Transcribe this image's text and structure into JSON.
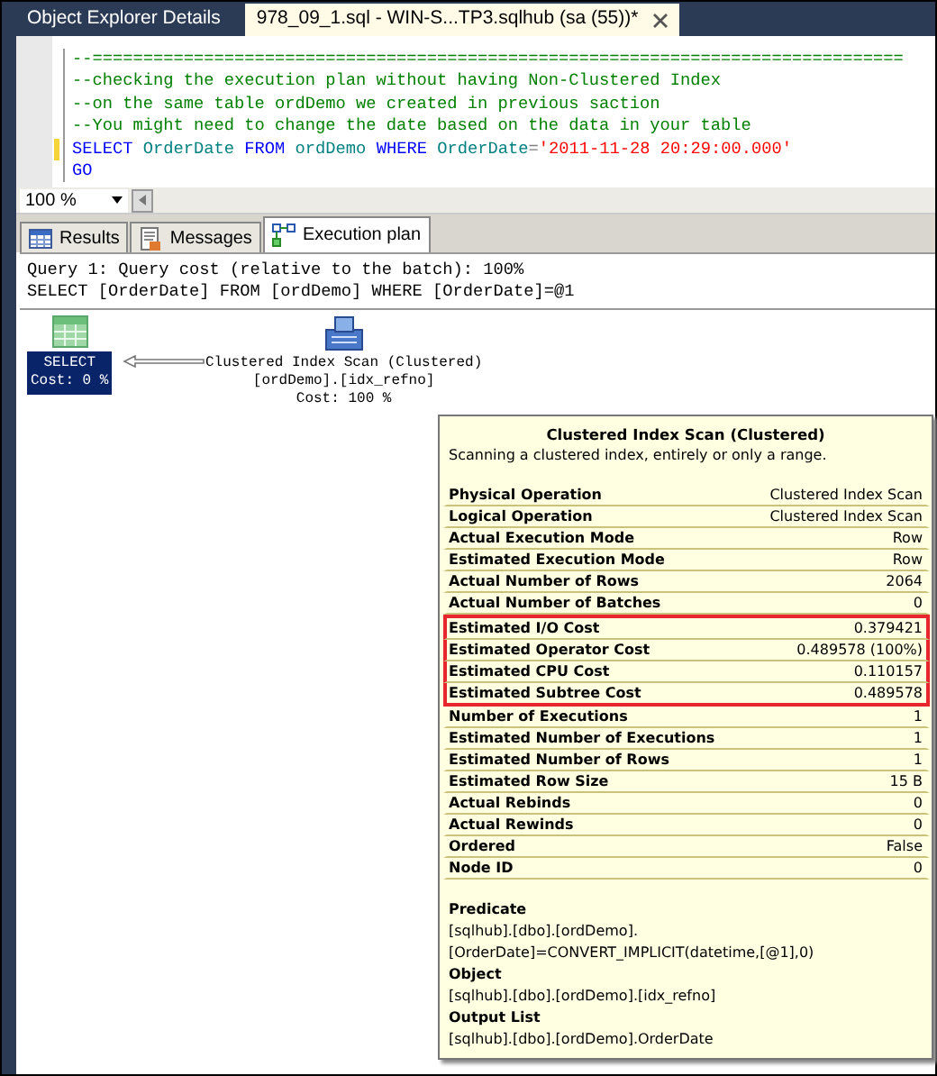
{
  "document_tabs": [
    {
      "label": "Object Explorer Details",
      "selected": false,
      "closable": false
    },
    {
      "label": "978_09_1.sql - WIN-S...TP3.sqlhub (sa (55))*",
      "selected": true,
      "closable": true
    }
  ],
  "editor": {
    "lines": [
      {
        "marked": false,
        "tokens": [
          {
            "kind": "comment",
            "text": "--================================================================================"
          }
        ]
      },
      {
        "marked": false,
        "tokens": [
          {
            "kind": "comment",
            "text": "--checking the execution plan without having Non-Clustered Index"
          }
        ]
      },
      {
        "marked": false,
        "tokens": [
          {
            "kind": "comment",
            "text": "--on the same table ordDemo we created in previous saction"
          }
        ]
      },
      {
        "marked": false,
        "tokens": [
          {
            "kind": "comment",
            "text": "--You might need to change the date based on the data in your table"
          }
        ]
      },
      {
        "marked": true,
        "tokens": [
          {
            "kind": "keyword",
            "text": "SELECT "
          },
          {
            "kind": "identifier",
            "text": "OrderDate "
          },
          {
            "kind": "keyword",
            "text": "FROM "
          },
          {
            "kind": "identifier",
            "text": "ordDemo "
          },
          {
            "kind": "keyword",
            "text": "WHERE "
          },
          {
            "kind": "identifier",
            "text": "OrderDate"
          },
          {
            "kind": "operator",
            "text": "="
          },
          {
            "kind": "string",
            "text": "'2011-11-28 20:29:00.000'"
          }
        ]
      },
      {
        "marked": false,
        "tokens": [
          {
            "kind": "keyword",
            "text": "GO"
          }
        ]
      }
    ]
  },
  "zoom": {
    "value": "100 %"
  },
  "result_tabs": [
    {
      "label": "Results",
      "kind": "grid",
      "selected": false
    },
    {
      "label": "Messages",
      "kind": "messages",
      "selected": false
    },
    {
      "label": "Execution plan",
      "kind": "plan",
      "selected": true
    }
  ],
  "plan": {
    "query_header": "Query 1: Query cost (relative to the batch): 100%",
    "statement": "SELECT [OrderDate] FROM [ordDemo] WHERE [OrderDate]=@1",
    "nodes": [
      {
        "kind": "select",
        "selected": true,
        "lines": [
          "SELECT",
          "Cost: 0 %"
        ]
      },
      {
        "kind": "scan",
        "selected": false,
        "lines": [
          "Clustered Index Scan (Clustered)",
          "[ordDemo].[idx_refno]",
          "Cost: 100 %"
        ]
      }
    ]
  },
  "tooltip": {
    "title": "Clustered Index Scan (Clustered)",
    "description": "Scanning a clustered index, entirely or only a range.",
    "properties": [
      {
        "label": "Physical Operation",
        "value": "Clustered Index Scan",
        "highlighted": false
      },
      {
        "label": "Logical Operation",
        "value": "Clustered Index Scan",
        "highlighted": false
      },
      {
        "label": "Actual Execution Mode",
        "value": "Row",
        "highlighted": false
      },
      {
        "label": "Estimated Execution Mode",
        "value": "Row",
        "highlighted": false
      },
      {
        "label": "Actual Number of Rows",
        "value": "2064",
        "highlighted": false
      },
      {
        "label": "Actual Number of Batches",
        "value": "0",
        "highlighted": false
      },
      {
        "label": "Estimated I/O Cost",
        "value": "0.379421",
        "highlighted": true
      },
      {
        "label": "Estimated Operator Cost",
        "value": "0.489578 (100%)",
        "highlighted": true
      },
      {
        "label": "Estimated CPU Cost",
        "value": "0.110157",
        "highlighted": true
      },
      {
        "label": "Estimated Subtree Cost",
        "value": "0.489578",
        "highlighted": true
      },
      {
        "label": "Number of Executions",
        "value": "1",
        "highlighted": false
      },
      {
        "label": "Estimated Number of Executions",
        "value": "1",
        "highlighted": false
      },
      {
        "label": "Estimated Number of Rows",
        "value": "1",
        "highlighted": false
      },
      {
        "label": "Estimated Row Size",
        "value": "15 B",
        "highlighted": false
      },
      {
        "label": "Actual Rebinds",
        "value": "0",
        "highlighted": false
      },
      {
        "label": "Actual Rewinds",
        "value": "0",
        "highlighted": false
      },
      {
        "label": "Ordered",
        "value": "False",
        "highlighted": false
      },
      {
        "label": "Node ID",
        "value": "0",
        "highlighted": false
      }
    ],
    "sections": [
      {
        "heading": "Predicate",
        "text": "[sqlhub].[dbo].[ordDemo].[OrderDate]=CONVERT_IMPLICIT(datetime,[@1],0)"
      },
      {
        "heading": "Object",
        "text": "[sqlhub].[dbo].[ordDemo].[idx_refno]"
      },
      {
        "heading": "Output List",
        "text": "[sqlhub].[dbo].[ordDemo].OrderDate"
      }
    ]
  }
}
